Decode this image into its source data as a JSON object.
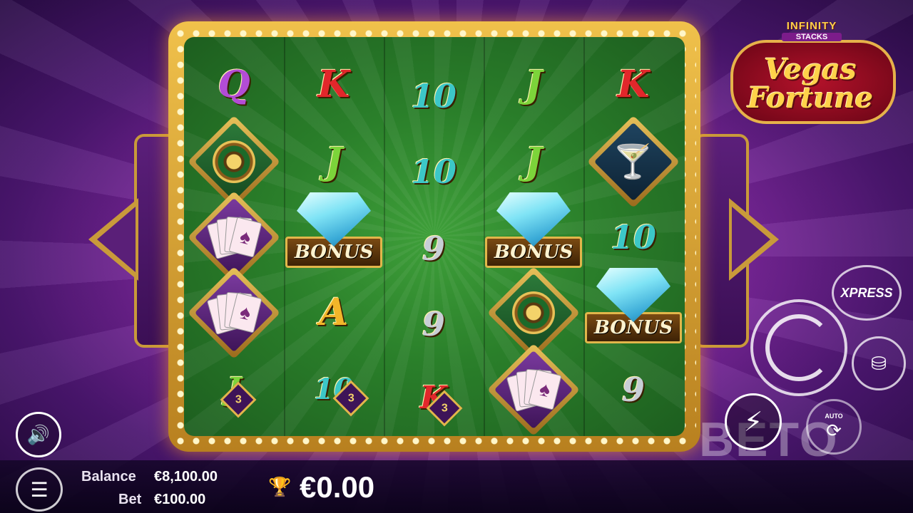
{
  "logo": {
    "line1": "INFINITY",
    "line2": "STACKS",
    "line3": "Vegas",
    "line4": "Fortune"
  },
  "reels": [
    {
      "symbols": [
        "Q",
        "roulette",
        "cards",
        "cards",
        "J×3"
      ]
    },
    {
      "symbols": [
        "K",
        "J",
        "BONUS",
        "A",
        "10×3"
      ]
    },
    {
      "symbols": [
        "10",
        "10",
        "9",
        "9",
        "K×3"
      ]
    },
    {
      "symbols": [
        "J",
        "J",
        "BONUS",
        "roulette",
        "cards"
      ]
    },
    {
      "symbols": [
        "K",
        "martini",
        "10",
        "BONUS",
        "9"
      ]
    }
  ],
  "symbols": {
    "r1": {
      "q": "Q",
      "j": "J",
      "m": "3"
    },
    "r2": {
      "k": "K",
      "j": "J",
      "a": "A",
      "ten": "10",
      "m": "3",
      "bonus": "BONUS"
    },
    "r3": {
      "ten1": "10",
      "ten2": "10",
      "nine1": "9",
      "nine2": "9",
      "k": "K",
      "m": "3"
    },
    "r4": {
      "j1": "J",
      "j2": "J",
      "bonus": "BONUS"
    },
    "r5": {
      "k": "K",
      "ten": "10",
      "bonus": "BONUS",
      "nine": "9"
    }
  },
  "controls": {
    "xpress": "XPRESS",
    "auto": "AUTO",
    "watermark": "BETO"
  },
  "footer": {
    "balance_label": "Balance",
    "balance_value": "€8,100.00",
    "bet_label": "Bet",
    "bet_value": "€100.00",
    "win_value": "€0.00"
  },
  "colors": {
    "board_green": "#2a7f2a",
    "frame_gold": "#e6b24a",
    "background_purple": "#8a2ca8"
  }
}
